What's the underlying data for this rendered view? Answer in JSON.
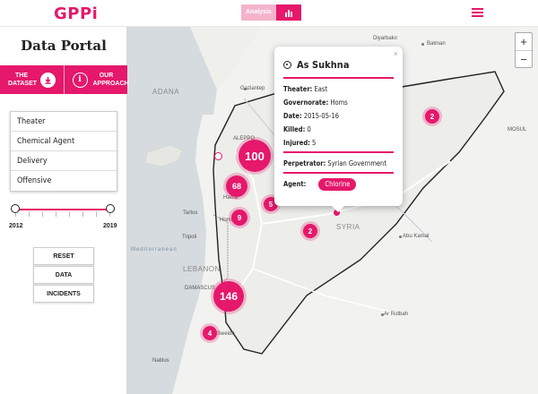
{
  "header": {
    "logo": "GPPi",
    "view_toggle_label": "Analysis",
    "chart_icon": "bar-chart-icon",
    "menu_icon": "hamburger-icon"
  },
  "sidebar": {
    "title": "Data Portal",
    "download_label_1": "THE",
    "download_label_2": "DATASET",
    "approach_label_1": "OUR",
    "approach_label_2": "APPROACH",
    "filters": [
      "Theater",
      "Chemical Agent",
      "Delivery",
      "Offensive"
    ],
    "year_start": "2012",
    "year_end": "2019",
    "actions": [
      "RESET",
      "DATA",
      "INCIDENTS"
    ]
  },
  "map": {
    "zoom_in": "+",
    "zoom_out": "−",
    "labels": {
      "adana": "ADANA",
      "gaziantep": "Gaziantep",
      "aleppo": "ALEPPO",
      "hama": "Hama",
      "tartus": "Tartus",
      "homs": "Homs",
      "tripoli": "Tripoli",
      "lebanon": "LEBANON",
      "damascus": "DAMASCUS",
      "syria": "SYRIA",
      "diyarbakir": "Diyarbakır",
      "batman": "Batman",
      "mosul": "MOSUL",
      "abu_kamal": "Abu Kamal",
      "ar_rutbah": "Ar Rutbah",
      "nablus": "Nablus",
      "sweida": "Sweida",
      "cyprus_sea": "Mediterranean"
    },
    "clusters": [
      {
        "name": "cluster-aleppo",
        "count": "100"
      },
      {
        "name": "cluster-idlib",
        "count": "68"
      },
      {
        "name": "cluster-hama",
        "count": "9"
      },
      {
        "name": "cluster-hama-east",
        "count": "5"
      },
      {
        "name": "cluster-palmyra",
        "count": "2"
      },
      {
        "name": "cluster-hasakah",
        "count": "2"
      },
      {
        "name": "cluster-damascus",
        "count": "146"
      },
      {
        "name": "cluster-daraa",
        "count": "4"
      }
    ]
  },
  "popup": {
    "title": "As Sukhna",
    "close": "×",
    "theater_label": "Theater:",
    "theater": "East",
    "governorate_label": "Governorate:",
    "governorate": "Homs",
    "date_label": "Date:",
    "date": "2015-05-16",
    "killed_label": "Killed:",
    "killed": "0",
    "injured_label": "Injured:",
    "injured": "5",
    "perpetrator_label": "Perpetrator:",
    "perpetrator": "Syrian Government",
    "agent_label": "Agent:",
    "agent": "Chlorine"
  },
  "colors": {
    "accent": "#e5186b",
    "accent_light": "#f4b3cb"
  }
}
